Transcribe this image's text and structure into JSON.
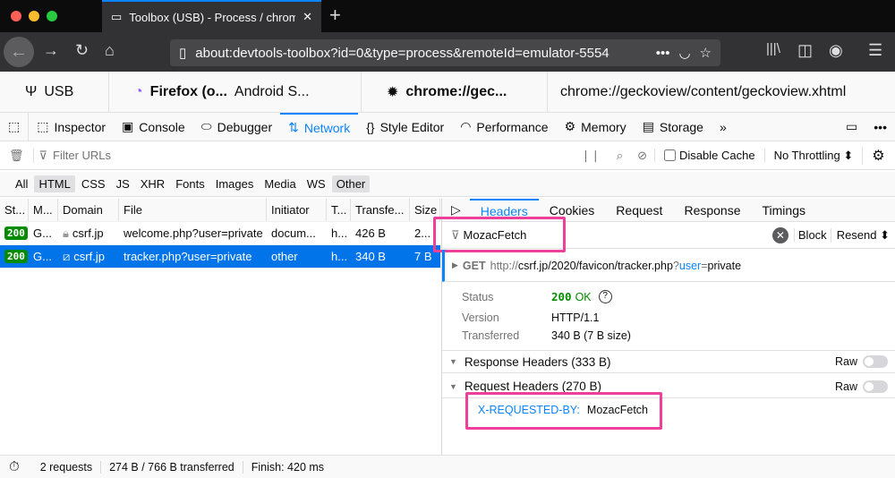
{
  "browser": {
    "tab_title": "Toolbox (USB) - Process / chrome://geckoview/content/geckoview.xhtml",
    "url": "about:devtools-toolbox?id=0&type=process&remoteId=emulator-5554",
    "new_tab": "+",
    "close": "✕"
  },
  "targets": {
    "connection": "USB",
    "app": "Firefox (o...",
    "device": "Android S...",
    "process": "chrome://gec...",
    "page": "chrome://geckoview/content/geckoview.xhtml"
  },
  "toolbox": {
    "tabs": [
      {
        "label": "Inspector",
        "icon": "inspector-icon"
      },
      {
        "label": "Console",
        "icon": "console-icon"
      },
      {
        "label": "Debugger",
        "icon": "debugger-icon"
      },
      {
        "label": "Network",
        "icon": "network-icon"
      },
      {
        "label": "Style Editor",
        "icon": "style-editor-icon"
      },
      {
        "label": "Performance",
        "icon": "performance-icon"
      },
      {
        "label": "Memory",
        "icon": "memory-icon"
      },
      {
        "label": "Storage",
        "icon": "storage-icon"
      }
    ],
    "selected": "Network",
    "more": "»"
  },
  "filter": {
    "placeholder": "Filter URLs",
    "disable_cache": "Disable Cache",
    "disable_cache_checked": false,
    "throttling": "No Throttling ⬍"
  },
  "types": [
    "All",
    "HTML",
    "CSS",
    "JS",
    "XHR",
    "Fonts",
    "Images",
    "Media",
    "WS",
    "Other"
  ],
  "types_active": [
    "HTML",
    "Other"
  ],
  "table": {
    "columns": [
      "St...",
      "M...",
      "Domain",
      "File",
      "Initiator",
      "T...",
      "Transfe...",
      "Size"
    ],
    "rows": [
      {
        "status": "200",
        "method": "G...",
        "domain": "csrf.jp",
        "file": "welcome.php?user=private",
        "initiator": "docum...",
        "type": "h...",
        "transferred": "426 B",
        "size": "2...",
        "secure": true,
        "selected": false
      },
      {
        "status": "200",
        "method": "G...",
        "domain": "csrf.jp",
        "file": "tracker.php?user=private",
        "initiator": "other",
        "type": "h...",
        "transferred": "340 B",
        "size": "7 B",
        "secure": false,
        "selected": true
      }
    ]
  },
  "details": {
    "tabs": [
      "Headers",
      "Cookies",
      "Request",
      "Response",
      "Timings"
    ],
    "selected": "Headers",
    "filter_value": "MozacFetch",
    "block": "Block",
    "resend": "Resend ⬍",
    "method": "GET",
    "url_prefix": "http://",
    "url_host_path": "csrf.jp/2020/favicon/tracker.php",
    "url_q": "?",
    "url_param": "user",
    "url_eq": "=",
    "url_value": "private",
    "status_label": "Status",
    "status_code": "200",
    "status_text": "OK",
    "version_label": "Version",
    "version": "HTTP/1.1",
    "transferred_label": "Transferred",
    "transferred": "340 B (7 B size)",
    "response_headers": "Response Headers (333 B)",
    "request_headers": "Request Headers (270 B)",
    "raw": "Raw",
    "header_name": "X-REQUESTED-BY:",
    "header_value": "MozacFetch"
  },
  "status": {
    "requests": "2 requests",
    "transferred": "274 B / 766 B transferred",
    "finish": "Finish: 420 ms"
  },
  "colors": {
    "accent": "#0a84ff",
    "selected_row": "#0074e8",
    "ok": "#058b00",
    "highlight": "#ee3f9a"
  }
}
